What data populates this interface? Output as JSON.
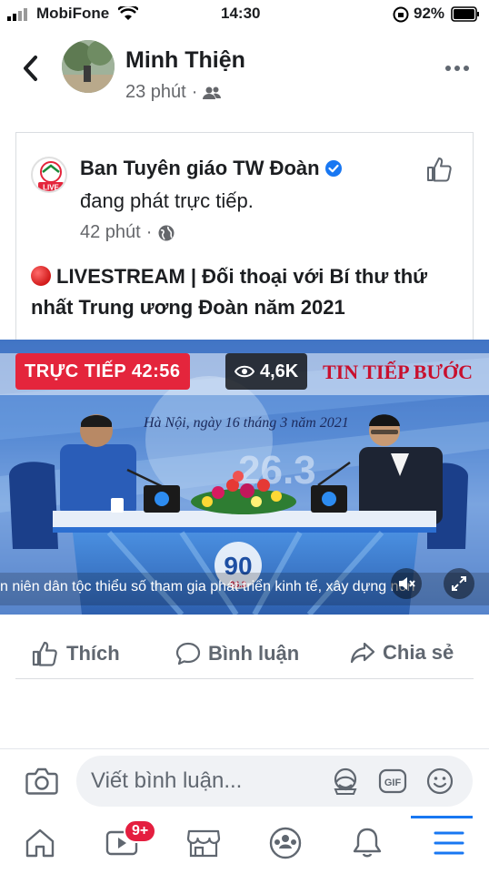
{
  "status_bar": {
    "carrier": "MobiFone",
    "time": "14:30",
    "battery": "92%"
  },
  "post": {
    "author": "Minh Thiện",
    "time": "23 phút",
    "audience_icon": "friends-icon"
  },
  "shared": {
    "page_name": "Ban Tuyên giáo TW Đoàn",
    "status": "đang phát trực tiếp.",
    "time": "42 phút",
    "text": "LIVESTREAM | Đối thoại với Bí thư thứ nhất Trung ương Đoàn năm 2021"
  },
  "video": {
    "live_label": "TRỰC TIẾP 42:56",
    "views": "4,6K",
    "banner": "TIN TIẾP BƯỚC",
    "date": "Hà Nội, ngày 16 tháng 3 năm 2021",
    "ticker": "n niên dân tộc thiểu số tham gia phát triển kinh tế, xây dựng nôn",
    "logo_number": "90",
    "logo_sub": "26.3"
  },
  "actions": {
    "like": "Thích",
    "comment": "Bình luận",
    "share": "Chia sẻ"
  },
  "comment_box": {
    "placeholder": "Viết bình luận..."
  },
  "nav": {
    "video_badge": "9+"
  },
  "colors": {
    "accent": "#1877f2",
    "live_red": "#e4253c",
    "badge_red": "#e41e3f"
  }
}
